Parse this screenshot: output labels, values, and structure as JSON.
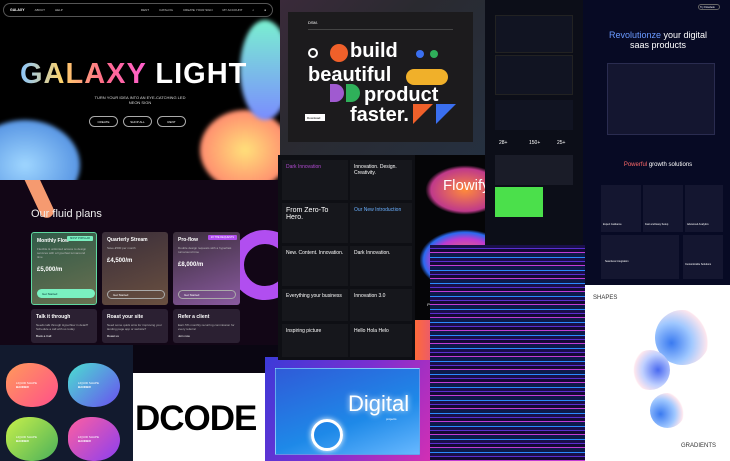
{
  "galaxy": {
    "nav": {
      "brand": "GALAXY",
      "links": [
        "ABOUT",
        "HELP",
        "RENT",
        "CATALOG",
        "CREATE YOUR SIGN",
        "MY ACCOUNT"
      ]
    },
    "title_a": "GALAXY",
    "title_b": "LIGHT",
    "subtitle": "TURN YOUR IDEA INTO AN EYE-CATCHING LED NEON SIGN",
    "buttons": [
      "CREATE",
      "SHOP ALL",
      "RENT"
    ]
  },
  "plans": {
    "title": "Our fluid plans",
    "cards": [
      {
        "name": "Monthly Flow",
        "tag": "MOST POPULAR",
        "desc": "Flexible & unlimited access to design services with a hyperfast turnaround time",
        "price": "£5,000/m",
        "cta": "Get Started"
      },
      {
        "name": "Quarterly Stream",
        "desc": "Save £500 per month",
        "price": "£4,500/m",
        "cta": "Get Started"
      },
      {
        "name": "Pro-flow",
        "tag": "2X THE REQUESTS",
        "desc": "Double design requests with a hyperfast turnaround time",
        "price": "£8,000/m",
        "cta": "Get Started"
      }
    ],
    "extras": [
      {
        "name": "Talk it through",
        "desc": "Needs talk through Hyperflow in detail? Schedule a call with us today",
        "link": "Book a Call"
      },
      {
        "name": "Roast your site",
        "desc": "Need some quick wins for improving your landing page app or website?",
        "link": "Roast us"
      },
      {
        "name": "Refer a client",
        "desc": "Earn 5% monthly recurring commission for every referral",
        "link": "Join now"
      }
    ]
  },
  "liquid": {
    "label": "LIQUID SHAPE",
    "sub": "BANNER"
  },
  "dcode": {
    "logo": "DCODE"
  },
  "digital": {
    "title": "Digital",
    "sub": "projects"
  },
  "build": {
    "brand": "DSM.",
    "words": [
      "build",
      "beautiful",
      "product",
      "faster."
    ],
    "cta": "Download"
  },
  "pres": {
    "slides": [
      "Dark Innovation",
      "Innovation. Design. Creativity.",
      "From Zero-To Hero.",
      "Our New Introduction",
      "New. Content. Innovation.",
      "Dark Innovation.",
      "Everything your business",
      "Innovation 3.0",
      "Inspiring picture",
      "Hello Hola Helo"
    ]
  },
  "flow": {
    "title": "Flowify",
    "tagline": "Perfect solution for presentations and social media"
  },
  "saas": {
    "headline_a": "Revolutionze",
    "headline_b": "your digital saas products",
    "section_a": "Powerful",
    "section_b": "growth solutions",
    "features": [
      "Expert Guidance",
      "Fast and Easy Setup",
      "Advanced Analytics",
      "Seamless Integration",
      "Customizable Solutions"
    ],
    "cta": "Try Flowdesk"
  },
  "green": {
    "stats": [
      "28+",
      "150+",
      "25+"
    ]
  },
  "shapes": {
    "title": "SHAPES",
    "bottom": "GRADIENTS"
  }
}
